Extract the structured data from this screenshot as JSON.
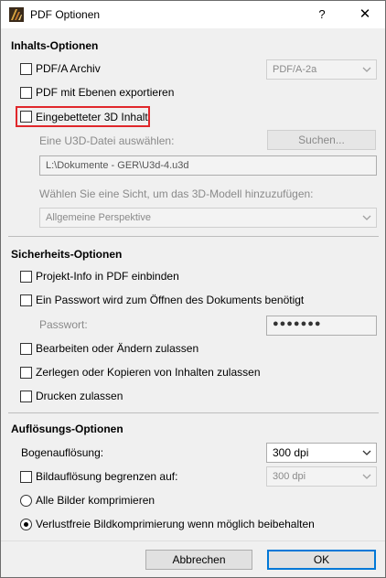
{
  "window": {
    "title": "PDF Optionen",
    "help_glyph": "?",
    "close_glyph": "✕"
  },
  "content": {
    "title": "Inhalts-Optionen",
    "pdfa_label": "PDF/A Archiv",
    "pdfa_combo_value": "PDF/A-2a",
    "layers_label": "PDF mit Ebenen exportieren",
    "embedded3d_label": "Eingebetteter 3D Inhalt",
    "u3d_prompt": "Eine U3D-Datei auswählen:",
    "search_button": "Suchen...",
    "u3d_path": "L:\\Dokumente - GER\\U3d-4.u3d",
    "view_prompt": "Wählen Sie eine Sicht, um das 3D-Modell hinzuzufügen:",
    "view_combo_value": "Allgemeine Perspektive"
  },
  "security": {
    "title": "Sicherheits-Optionen",
    "project_info_label": "Projekt-Info in PDF einbinden",
    "password_required_label": "Ein Passwort wird zum Öffnen des Dokuments benötigt",
    "password_label": "Passwort:",
    "password_mask": "●●●●●●●",
    "edit_label": "Bearbeiten oder Ändern zulassen",
    "copy_label": "Zerlegen oder Kopieren von Inhalten zulassen",
    "print_label": "Drucken zulassen"
  },
  "resolution": {
    "title": "Auflösungs-Optionen",
    "arc_label": "Bogenauflösung:",
    "arc_value": "300 dpi",
    "limit_label": "Bildauflösung begrenzen auf:",
    "limit_value": "300 dpi",
    "compress_all_label": "Alle Bilder komprimieren",
    "lossless_label": "Verlustfreie Bildkomprimierung wenn möglich beibehalten"
  },
  "footer": {
    "cancel_label": "Abbrechen",
    "ok_label": "OK"
  },
  "colors": {
    "highlight": "#e0272b",
    "default_button_border": "#0078d7"
  }
}
